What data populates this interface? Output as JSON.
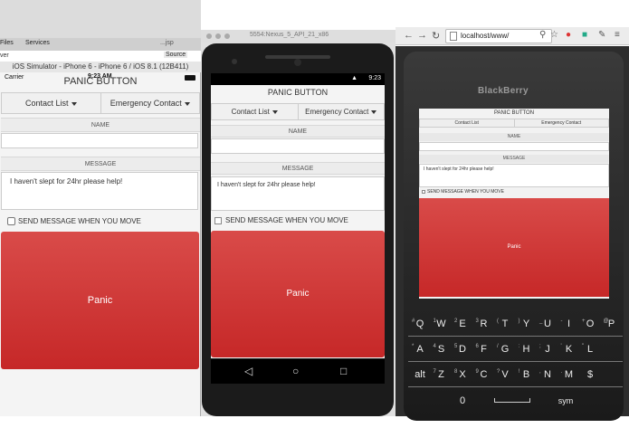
{
  "ide": {
    "tabs": [
      "Files",
      "Services"
    ],
    "tab_right": "...jsp",
    "source_tab": "Source",
    "stray_text": "ver"
  },
  "ios": {
    "window_title": "iOS Simulator - iPhone 6 - iPhone 6 / iOS 8.1 (12B411)",
    "status": {
      "carrier": "Carrier",
      "time": "9:23 AM"
    },
    "app": {
      "title": "PANIC BUTTON",
      "nav": [
        "Contact List",
        "Emergency Contact"
      ],
      "name_label": "NAME",
      "name_value": "",
      "message_label": "MESSAGE",
      "message_value": "I haven't slept for 24hr please help!",
      "checkbox_label": "SEND MESSAGE WHEN YOU MOVE",
      "panic_label": "Panic"
    }
  },
  "android": {
    "window_title": "5554:Nexus_5_API_21_x86",
    "status": {
      "time": "9:23"
    },
    "app": {
      "title": "PANIC BUTTON",
      "nav": [
        "Contact List",
        "Emergency Contact"
      ],
      "name_label": "NAME",
      "name_value": "",
      "message_label": "MESSAGE",
      "message_value": "I haven't slept for 24hr please help!",
      "checkbox_label": "SEND MESSAGE WHEN YOU MOVE",
      "panic_label": "Panic"
    }
  },
  "chrome": {
    "url": "localhost/www/"
  },
  "blackberry": {
    "brand": "BlackBerry",
    "app": {
      "title": "PANIC BUTTON",
      "nav": [
        "Contact List",
        "Emergency Contact"
      ],
      "name_label": "NAME",
      "name_value": "",
      "message_label": "MESSAGE",
      "message_value": "I haven't slept for 24hr please help!",
      "checkbox_label": "SEND MESSAGE WHEN YOU MOVE",
      "panic_label": "Panic"
    },
    "keyboard": {
      "row1": [
        [
          "#",
          "Q"
        ],
        [
          "1",
          "W"
        ],
        [
          "2",
          "E"
        ],
        [
          "3",
          "R"
        ],
        [
          "(",
          "T"
        ],
        [
          ")",
          "Y"
        ],
        [
          "_",
          "U"
        ],
        [
          "-",
          "I"
        ],
        [
          "+",
          "O"
        ],
        [
          "@",
          "P"
        ]
      ],
      "row2": [
        [
          "*",
          "A"
        ],
        [
          "4",
          "S"
        ],
        [
          "5",
          "D"
        ],
        [
          "6",
          "F"
        ],
        [
          "/",
          "G"
        ],
        [
          ":",
          "H"
        ],
        [
          ";",
          "J"
        ],
        [
          "'",
          "K"
        ],
        [
          "\"",
          "L"
        ],
        [
          "",
          ""
        ]
      ],
      "row3": [
        [
          "",
          "alt"
        ],
        [
          "7",
          "Z"
        ],
        [
          "8",
          "X"
        ],
        [
          "9",
          "C"
        ],
        [
          "?",
          "V"
        ],
        [
          "!",
          "B"
        ],
        [
          ",",
          "N"
        ],
        [
          ".",
          "M"
        ],
        [
          "",
          "$"
        ],
        [
          "",
          ""
        ]
      ],
      "row4": [
        "0",
        "sym"
      ]
    }
  },
  "colors": {
    "panic_red": "#d32f2f",
    "panic_red_light": "#d94b49",
    "panel_bg": "#f4f4f4"
  }
}
